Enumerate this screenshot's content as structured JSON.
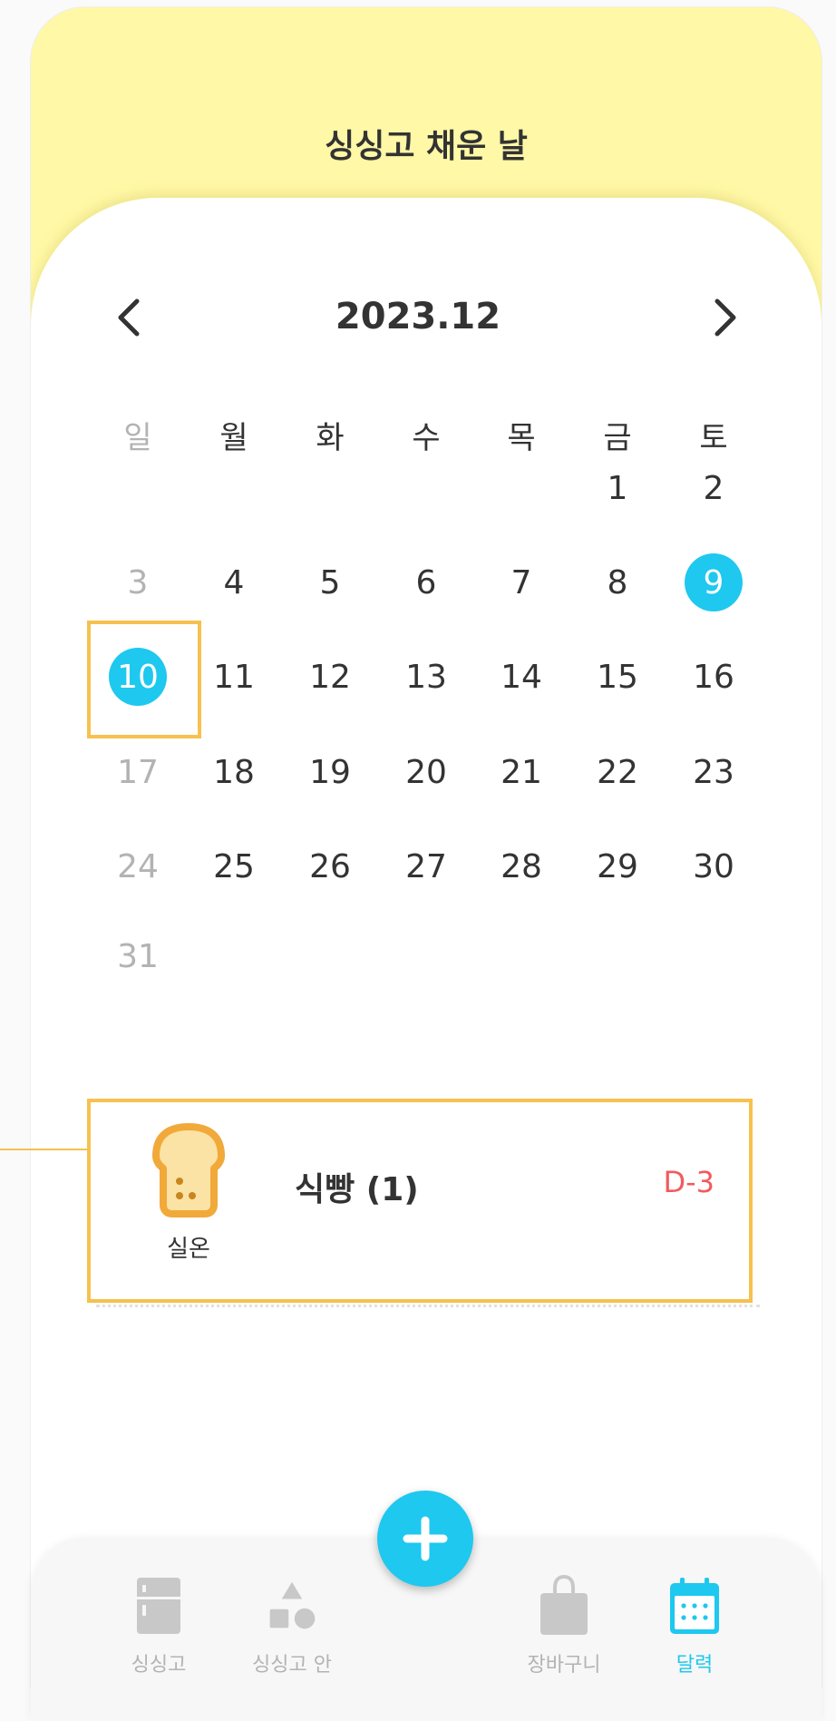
{
  "header": {
    "title": "싱싱고 채운 날"
  },
  "calendar": {
    "month_label": "2023.12",
    "weekdays": [
      "일",
      "월",
      "화",
      "수",
      "목",
      "금",
      "토"
    ],
    "weeks": [
      [
        "",
        "",
        "",
        "",
        "",
        "1",
        "2"
      ],
      [
        "3",
        "4",
        "5",
        "6",
        "7",
        "8",
        "9"
      ],
      [
        "10",
        "11",
        "12",
        "13",
        "14",
        "15",
        "16"
      ],
      [
        "17",
        "18",
        "19",
        "20",
        "21",
        "22",
        "23"
      ],
      [
        "24",
        "25",
        "26",
        "27",
        "28",
        "29",
        "30"
      ],
      [
        "31",
        "",
        "",
        "",
        "",
        "",
        ""
      ]
    ],
    "marked_days": [
      "9",
      "10"
    ],
    "selected_day": "10"
  },
  "item": {
    "icon": "bread-icon",
    "storage": "실온",
    "name": "식빵 (1)",
    "dday": "D-3"
  },
  "tabs": [
    {
      "label": "싱싱고",
      "icon": "fridge-icon"
    },
    {
      "label": "싱싱고 안",
      "icon": "shapes-icon"
    },
    {
      "label": "장바구니",
      "icon": "shopping-bag-icon"
    },
    {
      "label": "달력",
      "icon": "calendar-icon",
      "active": true
    }
  ],
  "colors": {
    "accent": "#1ec8ef",
    "header_bg": "#fff8a6",
    "highlight": "#f6c14e",
    "dday": "#f2595e",
    "inactive": "#b3b3b3"
  }
}
